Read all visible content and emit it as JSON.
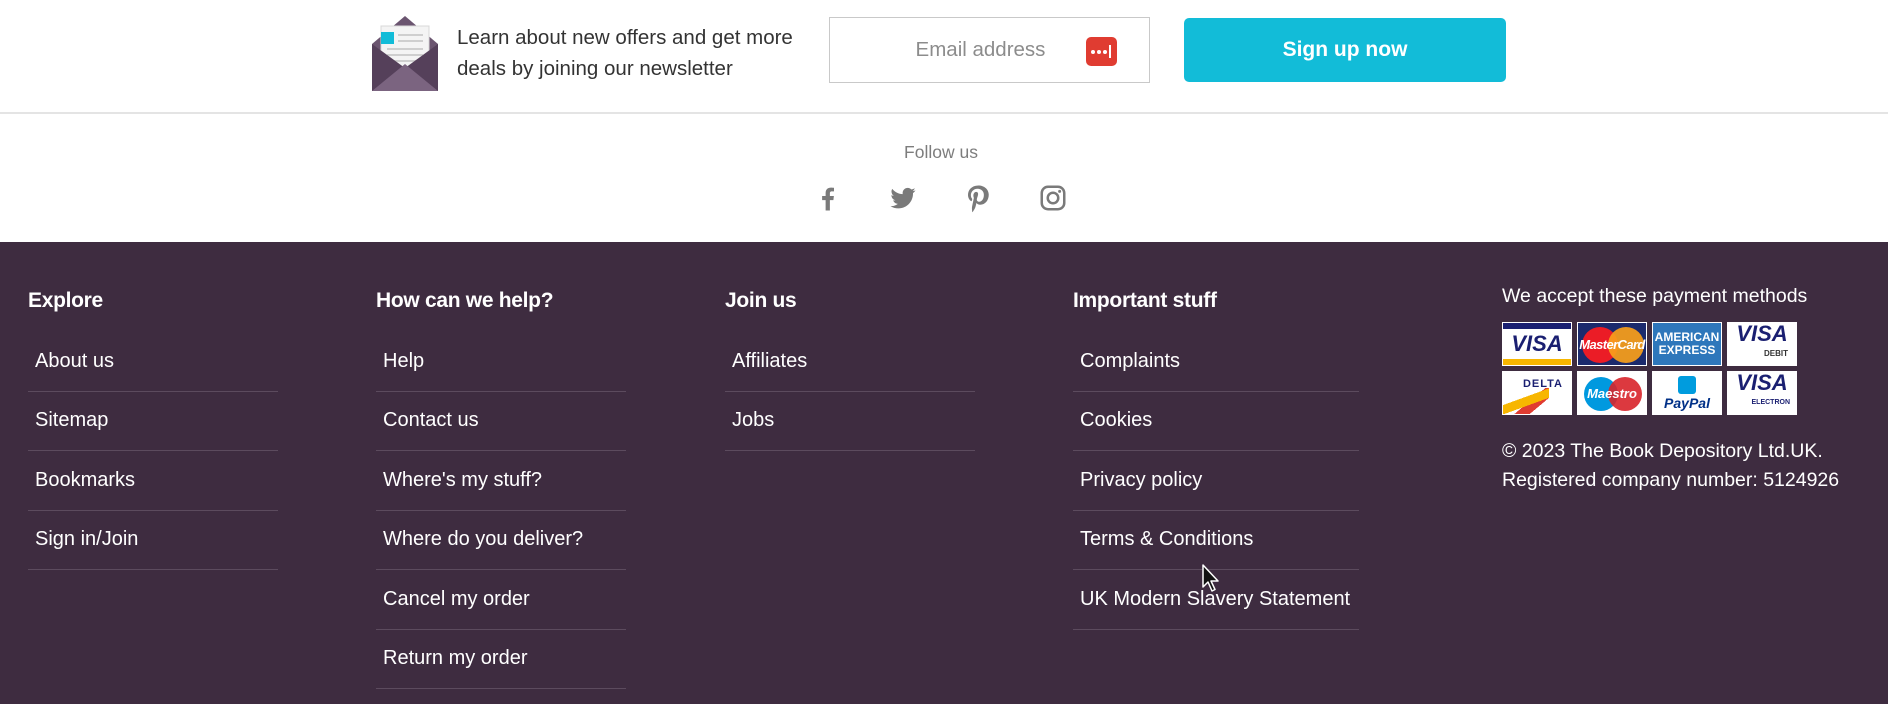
{
  "newsletter": {
    "text": "Learn about new offers and get more deals by joining our newsletter",
    "email_placeholder": "Email address",
    "signup_label": "Sign up now",
    "icon": "envelope-icon"
  },
  "follow": {
    "label": "Follow us",
    "icons": [
      "facebook-icon",
      "twitter-icon",
      "pinterest-icon",
      "instagram-icon"
    ]
  },
  "footer": {
    "explore": {
      "title": "Explore",
      "items": [
        "About us",
        "Sitemap",
        "Bookmarks",
        "Sign in/Join"
      ]
    },
    "help": {
      "title": "How can we help?",
      "items": [
        "Help",
        "Contact us",
        "Where's my stuff?",
        "Where do you deliver?",
        "Cancel my order",
        "Return my order"
      ]
    },
    "join": {
      "title": "Join us",
      "items": [
        "Affiliates",
        "Jobs"
      ]
    },
    "important": {
      "title": "Important stuff",
      "items": [
        "Complaints",
        "Cookies",
        "Privacy policy",
        "Terms & Conditions",
        "UK Modern Slavery Statement"
      ]
    },
    "payment": {
      "title": "We accept these payment methods",
      "cards": {
        "visa": "VISA",
        "mastercard": "MasterCard",
        "amex": "AMERICAN EXPRESS",
        "visa_debit": "VISA",
        "visa_debit_sub": "DEBIT",
        "delta": "DELTA",
        "maestro": "Maestro",
        "paypal": "PayPal",
        "visa_electron": "VISA",
        "visa_electron_sub": "ELECTRON"
      }
    },
    "copyright_line1": "© 2023  The Book Depository Ltd.UK.",
    "copyright_line2": "Registered company number: 5124926"
  },
  "colors": {
    "footer_bg": "#3e2c40",
    "signup_bg": "#12bcd8",
    "password_badge": "#e03c31"
  }
}
